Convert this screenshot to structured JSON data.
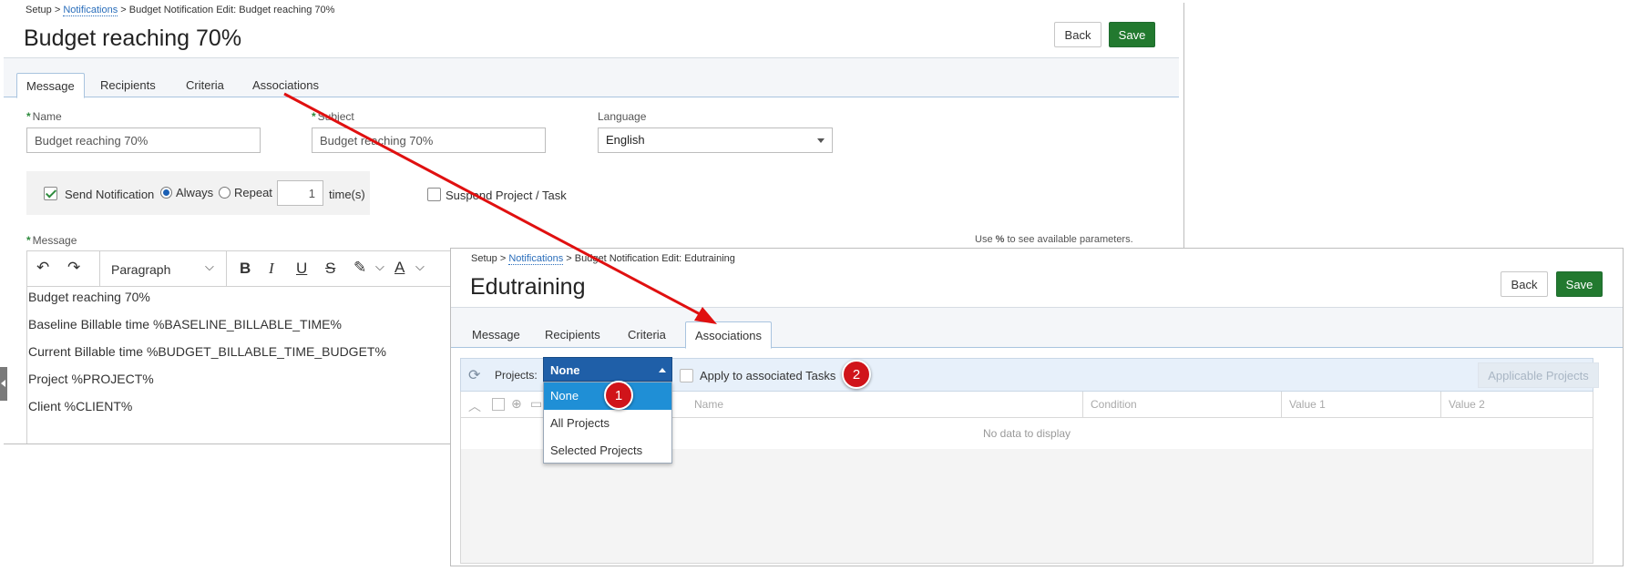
{
  "panel1": {
    "breadcrumb": {
      "root": "Setup",
      "sep1": ">",
      "link": "Notifications",
      "sep2": ">",
      "current": "Budget Notification Edit: Budget reaching 70%"
    },
    "title": "Budget reaching 70%",
    "back_label": "Back",
    "save_label": "Save",
    "tabs": [
      "Message",
      "Recipients",
      "Criteria",
      "Associations"
    ],
    "active_tab": "Message",
    "name_label": "Name",
    "name_value": "Budget reaching 70%",
    "subject_label": "Subject",
    "subject_value": "Budget reaching 70%",
    "language_label": "Language",
    "language_value": "English",
    "send_notification_label": "Send Notification",
    "always_label": "Always",
    "repeat_label": "Repeat",
    "repeat_count": "1",
    "times_label": "time(s)",
    "suspend_label": "Suspend Project / Task",
    "message_label": "Message",
    "params_hint_pre": "Use",
    "params_hint_symbol": "%",
    "params_hint_post": "to see available parameters.",
    "paragraph_style": "Paragraph",
    "message_lines": [
      "Budget reaching 70%",
      "Baseline Billable time %BASELINE_BILLABLE_TIME%",
      "Current Billable time %BUDGET_BILLABLE_TIME_BUDGET%",
      "Project %PROJECT%",
      "Client %CLIENT%"
    ]
  },
  "panel2": {
    "breadcrumb": {
      "root": "Setup",
      "sep1": ">",
      "link": "Notifications",
      "sep2": ">",
      "current": "Budget Notification Edit: Edutraining"
    },
    "title": "Edutraining",
    "back_label": "Back",
    "save_label": "Save",
    "tabs": [
      "Message",
      "Recipients",
      "Criteria",
      "Associations"
    ],
    "active_tab": "Associations",
    "projects_label": "Projects:",
    "projects_value": "None",
    "apply_tasks_label": "Apply to associated Tasks",
    "applicable_projects_label": "Applicable Projects",
    "columns": [
      "Name",
      "Condition",
      "Value 1",
      "Value 2"
    ],
    "no_data": "No data to display",
    "dropdown_options": [
      "None",
      "All Projects",
      "Selected Projects"
    ],
    "dropdown_selected": "None"
  },
  "callouts": [
    "1",
    "2"
  ],
  "colors": {
    "accent_blue": "#1f5fa8",
    "save_green": "#22792f",
    "callout_red": "#d0141a",
    "arrow_red": "#e01010"
  }
}
